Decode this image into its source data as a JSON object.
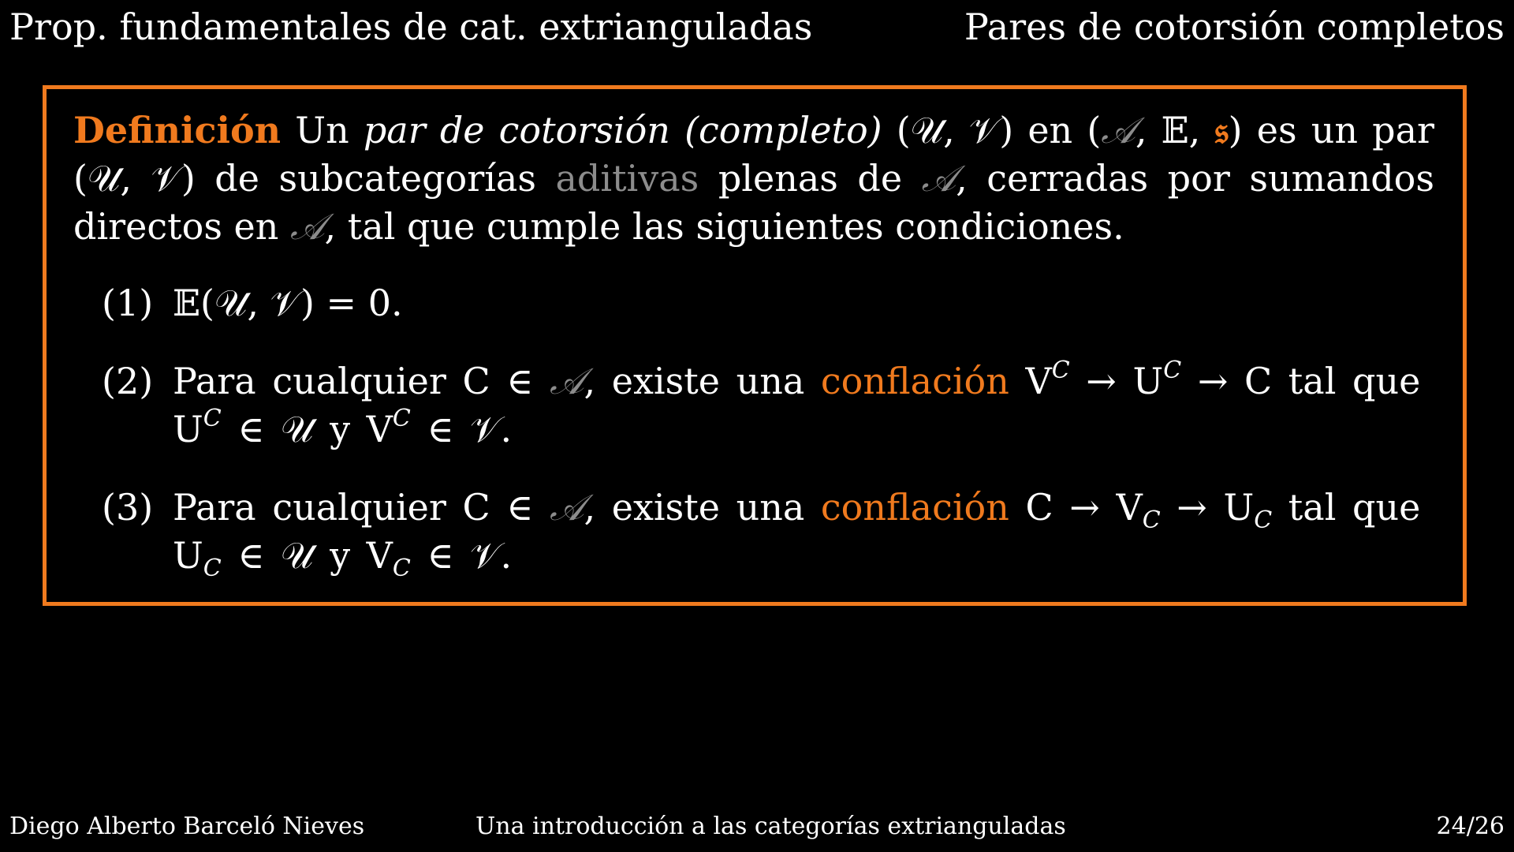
{
  "header": {
    "left": "Prop. fundamentales de cat. extrianguladas",
    "right": "Pares de cotorsión completos"
  },
  "definition": {
    "title": "Definición",
    "intro_1": "Un ",
    "term": "par de cotorsión (completo)",
    "pair": "(𝒰, 𝒱)",
    "en": " en ",
    "triple_open": "(",
    "cat_A": "𝒜",
    "triple_mid": ", 𝔼, ",
    "frak_s": "𝔰",
    "triple_close": ")",
    "intro_2": " es un par (𝒰, 𝒱)",
    "line2_a": "de subcategorías ",
    "aditivas": "aditivas",
    "line2_b": " plenas de ",
    "line2_c": ", cerradas por sumandos directos en ",
    "line2_d": ",",
    "line3": "tal que cumple las siguientes condiciones."
  },
  "conditions": [
    {
      "num": "(1)",
      "text": "𝔼(𝒰, 𝒱) = 0."
    },
    {
      "num": "(2)",
      "pre": "Para cualquier C ∈ ",
      "cat": "𝒜",
      "mid": ", existe una ",
      "keyword": "conflación",
      "post": " V",
      "sup1": "C",
      "arrow1": " → U",
      "sup2": "C",
      "arrow2": " → C tal que",
      "line2_a": "U",
      "line2_sup1": "C",
      "line2_b": " ∈ 𝒰 y V",
      "line2_sup2": "C",
      "line2_c": " ∈ 𝒱."
    },
    {
      "num": "(3)",
      "pre": "Para cualquier C ∈ ",
      "cat": "𝒜",
      "mid": ", existe una ",
      "keyword": "conflación",
      "post": " C → V",
      "sub1": "C",
      "arrow1": " → U",
      "sub2": "C",
      "arrow2": " tal que",
      "line2_a": "U",
      "line2_sub1": "C",
      "line2_b": " ∈ 𝒰 y V",
      "line2_sub2": "C",
      "line2_c": " ∈ 𝒱."
    }
  ],
  "footer": {
    "author": "Diego Alberto Barceló Nieves",
    "title": "Una introducción a las categorías extrianguladas",
    "page": "24/26"
  },
  "colors": {
    "accent": "#f07a1e",
    "muted": "#8c8c8c",
    "background": "#000000",
    "text": "#ffffff"
  }
}
